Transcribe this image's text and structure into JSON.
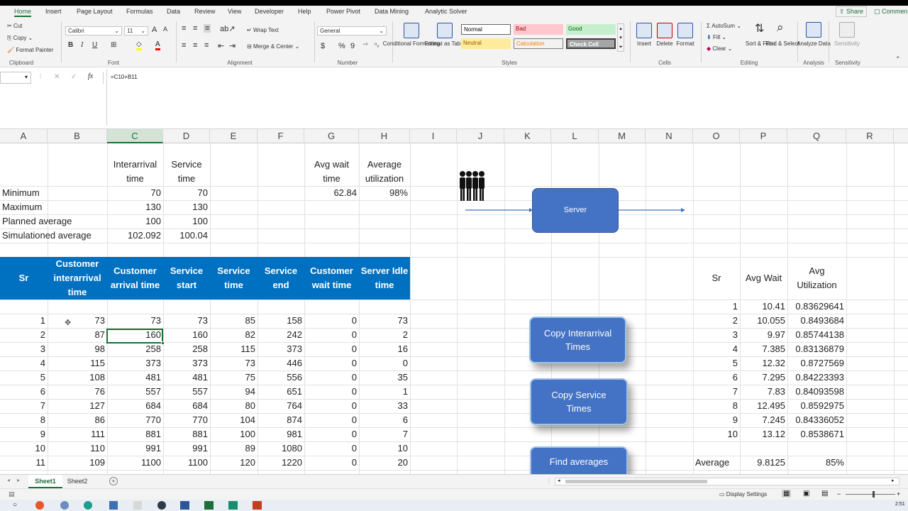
{
  "ribbon_tabs": [
    "Home",
    "Insert",
    "Page Layout",
    "Formulas",
    "Data",
    "Review",
    "View",
    "Developer",
    "Help",
    "Power Pivot",
    "Data Mining",
    "Analytic Solver"
  ],
  "share_label": "Share",
  "comments_label": "Commen",
  "clipboard": {
    "cut": "Cut",
    "copy": "Copy",
    "format_painter": "Format Painter",
    "group": "Clipboard",
    "paste_icon": "paste-icon"
  },
  "font": {
    "name": "Calibri",
    "size": "11",
    "bold": "B",
    "italic": "I",
    "underline": "U",
    "group": "Font"
  },
  "alignment": {
    "wrap": "Wrap Text",
    "merge": "Merge & Center",
    "group": "Alignment"
  },
  "number": {
    "format": "General",
    "currency": "$",
    "percent": "%",
    "comma": "9",
    "group": "Number"
  },
  "styles": {
    "conditional": "Conditional Formatting",
    "format_table": "Format as Table",
    "cells": [
      {
        "label": "Normal",
        "bg": "#ffffff",
        "fg": "#000000"
      },
      {
        "label": "Bad",
        "bg": "#ffc7ce",
        "fg": "#9c0006"
      },
      {
        "label": "Good",
        "bg": "#c6efce",
        "fg": "#006100"
      },
      {
        "label": "Neutral",
        "bg": "#ffeb9c",
        "fg": "#9c5700"
      },
      {
        "label": "Calculation",
        "bg": "#f2f2f2",
        "fg": "#fa7d00"
      },
      {
        "label": "Check Cell",
        "bg": "#a5a5a5",
        "fg": "#ffffff"
      }
    ],
    "group": "Styles"
  },
  "cells_group": {
    "insert": "Insert",
    "delete": "Delete",
    "format": "Format",
    "group": "Cells"
  },
  "editing": {
    "autosum": "AutoSum",
    "fill": "Fill",
    "clear": "Clear",
    "sort": "Sort & Filter",
    "find": "Find & Select",
    "group": "Editing"
  },
  "analysis": {
    "analyze": "Analyze Data",
    "group": "Analysis"
  },
  "sensitivity": {
    "label": "Sensitivity",
    "group": "Sensitivity"
  },
  "formula_bar": {
    "name_box": "",
    "fx": "fx",
    "formula": "=C10+B11"
  },
  "columns": [
    "A",
    "B",
    "C",
    "D",
    "E",
    "F",
    "G",
    "H",
    "I",
    "J",
    "K",
    "L",
    "M",
    "N",
    "O",
    "P",
    "Q",
    "R"
  ],
  "selected_column": "C",
  "summary": {
    "col_c_header": "Interarrival time",
    "col_d_header": "Service time",
    "col_g_header": "Avg wait time",
    "col_h_header": "Average utilization",
    "rows": [
      {
        "label": "Minimum",
        "c": "70",
        "d": "70"
      },
      {
        "label": "Maximum",
        "c": "130",
        "d": "130"
      },
      {
        "label": "Planned average",
        "c": "100",
        "d": "100"
      },
      {
        "label": "Simulationed average",
        "c": "102.092",
        "d": "100.04"
      }
    ],
    "avg_wait": "62.84",
    "avg_util": "98%"
  },
  "sim_headers": [
    "Sr",
    "Customer interarrival time",
    "Customer arrival time",
    "Service start",
    "Service time",
    "Service end",
    "Customer wait time",
    "Server Idle time"
  ],
  "sim_rows": [
    [
      "1",
      "73",
      "73",
      "73",
      "85",
      "158",
      "0",
      "73"
    ],
    [
      "2",
      "87",
      "160",
      "160",
      "82",
      "242",
      "0",
      "2"
    ],
    [
      "3",
      "98",
      "258",
      "258",
      "115",
      "373",
      "0",
      "16"
    ],
    [
      "4",
      "115",
      "373",
      "373",
      "73",
      "446",
      "0",
      "0"
    ],
    [
      "5",
      "108",
      "481",
      "481",
      "75",
      "556",
      "0",
      "35"
    ],
    [
      "6",
      "76",
      "557",
      "557",
      "94",
      "651",
      "0",
      "1"
    ],
    [
      "7",
      "127",
      "684",
      "684",
      "80",
      "764",
      "0",
      "33"
    ],
    [
      "8",
      "86",
      "770",
      "770",
      "104",
      "874",
      "0",
      "6"
    ],
    [
      "9",
      "111",
      "881",
      "881",
      "100",
      "981",
      "0",
      "7"
    ],
    [
      "10",
      "110",
      "991",
      "991",
      "89",
      "1080",
      "0",
      "10"
    ],
    [
      "11",
      "109",
      "1100",
      "1100",
      "120",
      "1220",
      "0",
      "20"
    ]
  ],
  "results": {
    "headers": [
      "Sr",
      "Avg Wait",
      "Avg Utilization"
    ],
    "rows": [
      [
        "1",
        "10.41",
        "0.83629641"
      ],
      [
        "2",
        "10.055",
        "0.8493684"
      ],
      [
        "3",
        "9.97",
        "0.85744138"
      ],
      [
        "4",
        "7.385",
        "0.83136879"
      ],
      [
        "5",
        "12.32",
        "0.8727569"
      ],
      [
        "6",
        "7.295",
        "0.84223393"
      ],
      [
        "7",
        "7.83",
        "0.84093598"
      ],
      [
        "8",
        "12.495",
        "0.8592975"
      ],
      [
        "9",
        "7.245",
        "0.84336052"
      ],
      [
        "10",
        "13.12",
        "0.8538671"
      ]
    ],
    "avg_label": "Average",
    "avg_wait": "9.8125",
    "avg_util": "85%"
  },
  "shapes": {
    "server": "Server",
    "copy_interarrival": "Copy Interarrival Times",
    "copy_service": "Copy Service Times",
    "find_averages": "Find averages",
    "people_icon": "people-queue-icon"
  },
  "sheets": [
    "Sheet1",
    "Sheet2"
  ],
  "active_sheet": "Sheet1",
  "status": {
    "display_settings": "Display Settings"
  },
  "taskbar": {
    "time": "2:51"
  }
}
